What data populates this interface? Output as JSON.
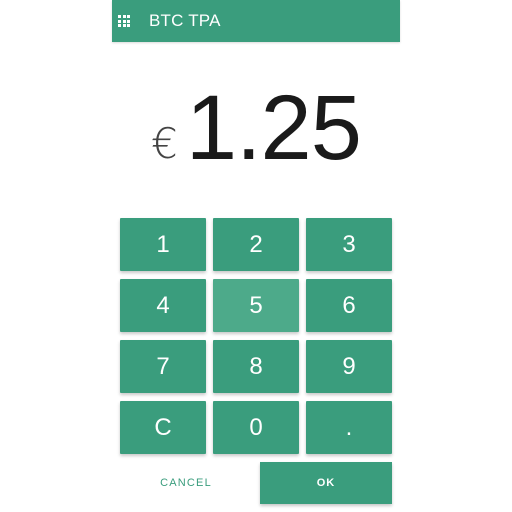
{
  "theme": {
    "accent": "#3a9d7d",
    "accent_pressed": "#4daa8a",
    "background": "#ffffff"
  },
  "appbar": {
    "menu_icon": "apps-grid-icon",
    "title": "BTC TPA"
  },
  "display": {
    "currency_symbol": "€",
    "amount": "1.25"
  },
  "keypad": {
    "keys": [
      "1",
      "2",
      "3",
      "4",
      "5",
      "6",
      "7",
      "8",
      "9",
      "C",
      "0",
      "."
    ],
    "pressed_key": "5"
  },
  "actions": {
    "cancel_label": "CANCEL",
    "ok_label": "OK"
  }
}
